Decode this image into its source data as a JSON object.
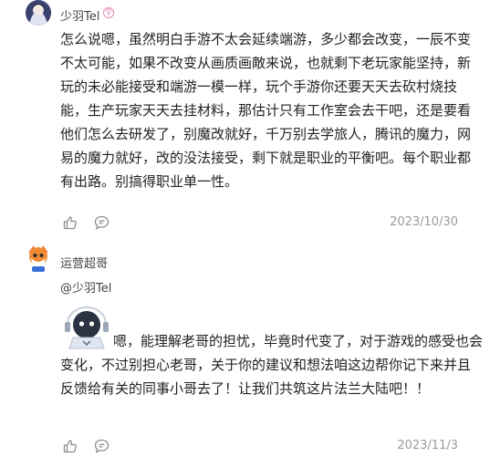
{
  "comments": [
    {
      "username": "少羽Tel",
      "badge": "♀",
      "text": "怎么说嗯，虽然明白手游不太会延续端游，多少都会改变，一辰不变不太可能，如果不改变从画质画敵来说，也就剩下老玩家能坚持，新玩的未必能接受和端游一模一样，玩个手游你还要天天去砍村烧技能，生产玩家天天去挂材料，那估计只有工作室会去干吧，还是要看他们怎么去研发了，别魔改就好，千万别去学旅人，腾讯的魔力，网易的魔力就好，改的没法接受，剩下就是职业的平衡吧。每个职业都有出路。别搞得职业单一性。",
      "date": "2023/10/30",
      "like_icon": "thumbs-up-icon",
      "reply_icon": "comment-bubble-icon"
    },
    {
      "username": "运营超哥",
      "mention": "@少羽Tel",
      "text": "嗯，能理解老哥的担忧，毕竟时代变了，对于游戏的感受也会变化，不过别担心老哥，关于你的建议和想法咱这边帮你记下来并且反馈给有关的同事小哥去了！让我们共筑这片法兰大陆吧！！",
      "date": "2023/11/3",
      "like_icon": "thumbs-up-icon",
      "reply_icon": "comment-bubble-icon"
    }
  ]
}
